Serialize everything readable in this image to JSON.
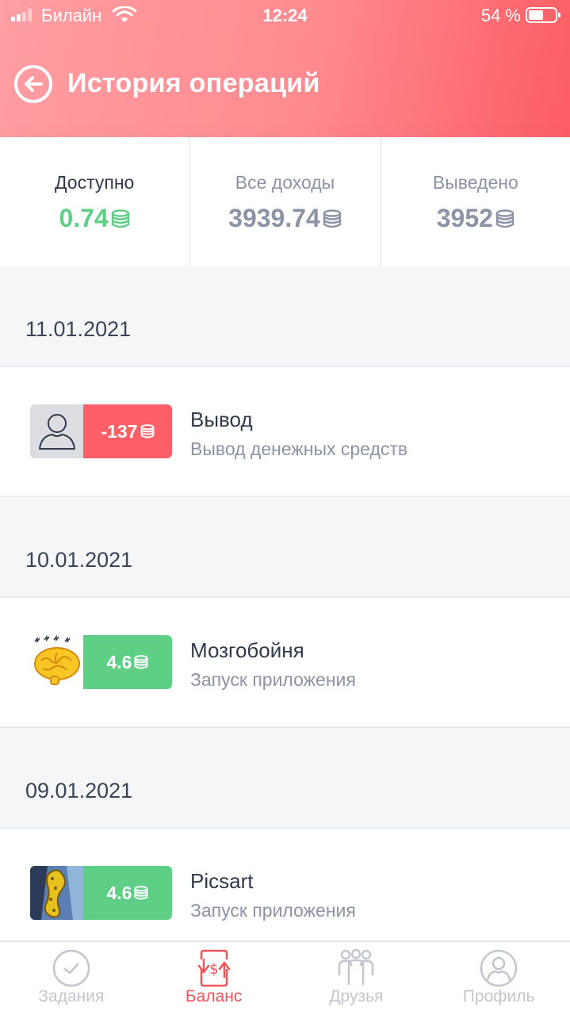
{
  "status_bar": {
    "carrier": "Билайн",
    "time": "12:24",
    "battery": "54 %"
  },
  "header": {
    "title": "История операций",
    "back_icon": "arrow-left-circle-icon"
  },
  "stats": [
    {
      "label": "Доступно",
      "value": "0.74"
    },
    {
      "label": "Все доходы",
      "value": "3939.74"
    },
    {
      "label": "Выведено",
      "value": "3952"
    }
  ],
  "colors": {
    "accent": "#f0555b",
    "positive": "#5fcf85",
    "negative": "#fc5f66",
    "muted": "#8a94a6"
  },
  "groups": [
    {
      "date": "11.01.2021",
      "operation": {
        "amount": "-137",
        "title": "Вывод",
        "subtitle": "Вывод денежных средств",
        "icon": "user-avatar-icon"
      }
    },
    {
      "date": "10.01.2021",
      "operation": {
        "amount": "4.6",
        "title": "Мозгобойня",
        "subtitle": "Запуск приложения",
        "icon": "brain-app-icon"
      }
    },
    {
      "date": "09.01.2021",
      "operation": {
        "amount": "4.6",
        "title": "Picsart",
        "subtitle": "Запуск приложения",
        "icon": "picsart-app-icon"
      }
    }
  ],
  "tabs": [
    {
      "label": "Задания",
      "icon": "check-circle-icon",
      "active": false
    },
    {
      "label": "Баланс",
      "icon": "balance-transfer-icon",
      "active": true
    },
    {
      "label": "Друзья",
      "icon": "friends-icon",
      "active": false
    },
    {
      "label": "Профиль",
      "icon": "profile-icon",
      "active": false
    }
  ]
}
